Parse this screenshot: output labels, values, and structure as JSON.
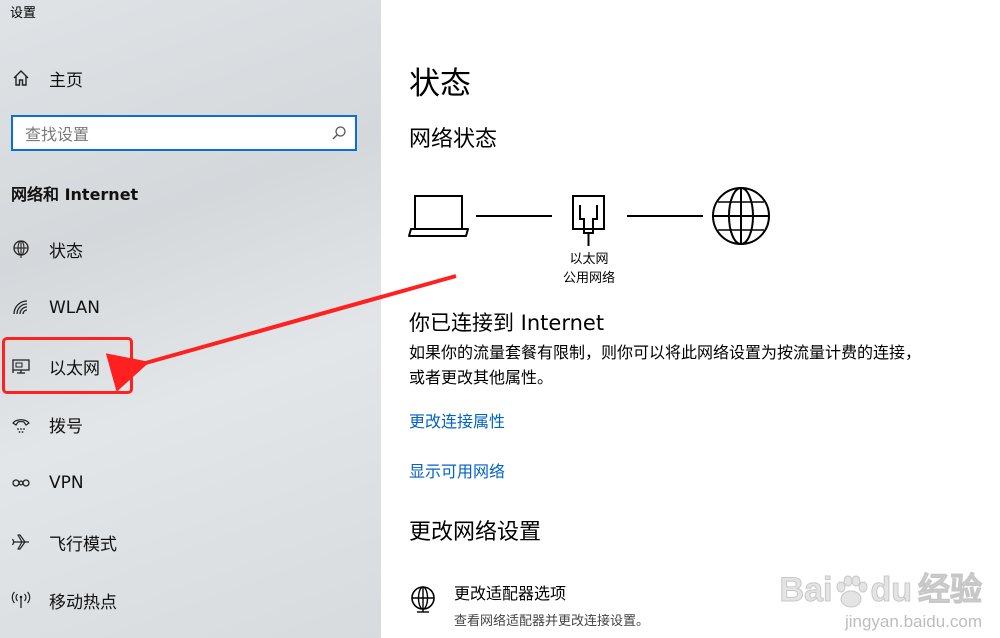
{
  "window": {
    "title": "设置"
  },
  "sidebar": {
    "home_label": "主页",
    "search_placeholder": "查找设置",
    "section_title": "网络和 Internet",
    "items": [
      {
        "label": "状态",
        "icon": "globe-status-icon"
      },
      {
        "label": "WLAN",
        "icon": "wifi-icon"
      },
      {
        "label": "以太网",
        "icon": "ethernet-icon"
      },
      {
        "label": "拨号",
        "icon": "dial-up-icon"
      },
      {
        "label": "VPN",
        "icon": "vpn-icon"
      },
      {
        "label": "飞行模式",
        "icon": "airplane-icon"
      },
      {
        "label": "移动热点",
        "icon": "hotspot-icon"
      }
    ]
  },
  "main": {
    "title": "状态",
    "network_status_title": "网络状态",
    "diagram": {
      "adapter_name": "以太网",
      "network_type": "公用网络"
    },
    "connected_title": "你已连接到 Internet",
    "connected_desc": "如果你的流量套餐有限制，则你可以将此网络设置为按流量计费的连接，或者更改其他属性。",
    "link_change_props": "更改连接属性",
    "link_show_networks": "显示可用网络",
    "change_settings_title": "更改网络设置",
    "adapter_option": {
      "title": "更改适配器选项",
      "desc": "查看网络适配器并更改连接设置。"
    }
  },
  "watermark": {
    "brand": "Bai",
    "brand2": "du",
    "brand_cn": "经验",
    "url": "jingyan.baidu.com"
  },
  "colors": {
    "accent": "#0a6fd4",
    "link": "#0062c4",
    "annotation": "#ff2020"
  }
}
